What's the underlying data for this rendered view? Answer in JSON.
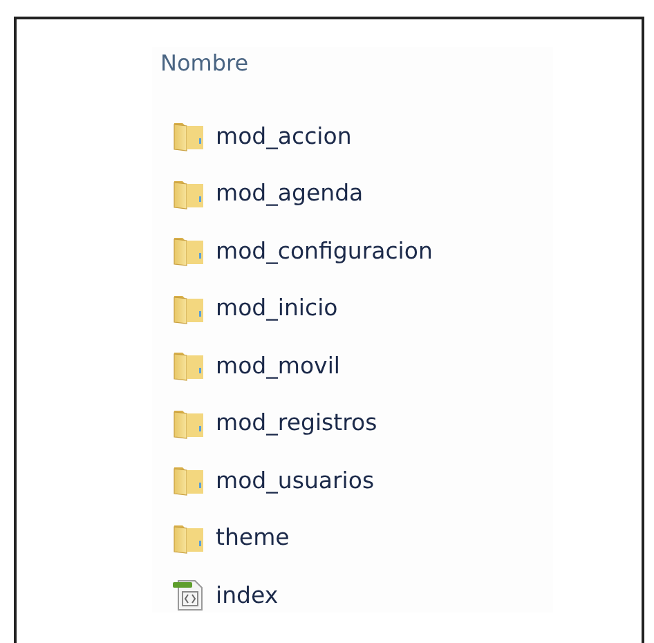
{
  "column_header": "Nombre",
  "items": [
    {
      "name": "mod_accion",
      "kind": "folder"
    },
    {
      "name": "mod_agenda",
      "kind": "folder"
    },
    {
      "name": "mod_configuracion",
      "kind": "folder"
    },
    {
      "name": "mod_inicio",
      "kind": "folder"
    },
    {
      "name": "mod_movil",
      "kind": "folder"
    },
    {
      "name": "mod_registros",
      "kind": "folder"
    },
    {
      "name": "mod_usuarios",
      "kind": "folder"
    },
    {
      "name": "theme",
      "kind": "folder"
    },
    {
      "name": "index",
      "kind": "web-file"
    }
  ]
}
